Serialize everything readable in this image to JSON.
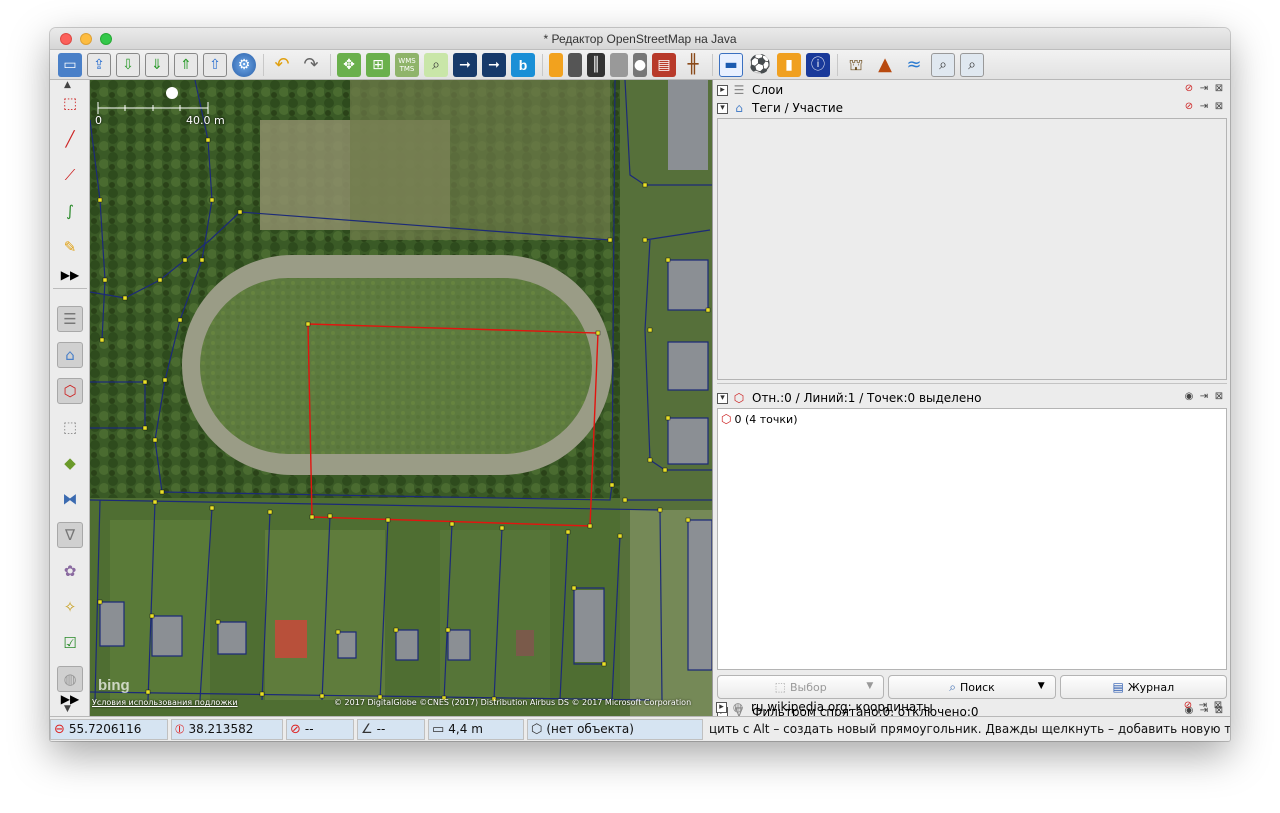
{
  "window": {
    "title": "* Редактор OpenStreetMap на Java"
  },
  "toolbar": {
    "icons": [
      "new-file-icon",
      "open-file-icon",
      "open-location-icon",
      "download-icon",
      "download-along-icon",
      "upload-icon",
      "preferences-icon",
      "undo-icon",
      "redo-icon",
      "zoom-to-data-icon",
      "zoom-to-selection-icon",
      "wms-layer-icon",
      "search-icon",
      "way-icon-1",
      "way-icon-2",
      "bing-layer-icon",
      "preset-road-icon-1",
      "preset-road-icon-2",
      "preset-road-icon-3",
      "preset-road-icon-4",
      "preset-traffic-icon",
      "preset-wall-icon",
      "preset-railway-icon",
      "preset-accommodation-icon",
      "preset-sport-icon",
      "preset-shop-icon",
      "preset-info-icon",
      "preset-industrial-icon",
      "preset-mountain-icon",
      "preset-waterway-icon",
      "search-preset-icon",
      "search-preset-icon-2"
    ],
    "wms_label": "WMS TMS"
  },
  "map": {
    "scale_start": "0",
    "scale_end": "40.0 m",
    "terms_link": "Условия использования подложки",
    "attribution": "© 2017 DigitalGlobe ©CNES (2017) Distribution Airbus DS © 2017 Microsoft Corporation",
    "bing_logo": "bing"
  },
  "panels": {
    "layers": {
      "title": "Слои"
    },
    "tags": {
      "title": "Теги / Участие"
    },
    "selection": {
      "title": "Отн.:0 / Линий:1 / Точек:0 выделено",
      "items": [
        "0 (4 точки)"
      ]
    },
    "buttons": {
      "select": "Выбор",
      "search": "Поиск",
      "history": "Журнал"
    },
    "filter": {
      "title": "Фильтром спрятано:0, отключено:0"
    },
    "wikipedia": {
      "title": "ru.wikipedia.org: координаты"
    }
  },
  "status": {
    "lat": "55.7206116",
    "lon": "38.213582",
    "heading": "--",
    "angle": "--",
    "distance": "4,4 m",
    "object": "(нет объекта)",
    "help": "цить с Alt – создать новый прямоугольник. Дважды щелкнуть – добавить новую точку."
  }
}
